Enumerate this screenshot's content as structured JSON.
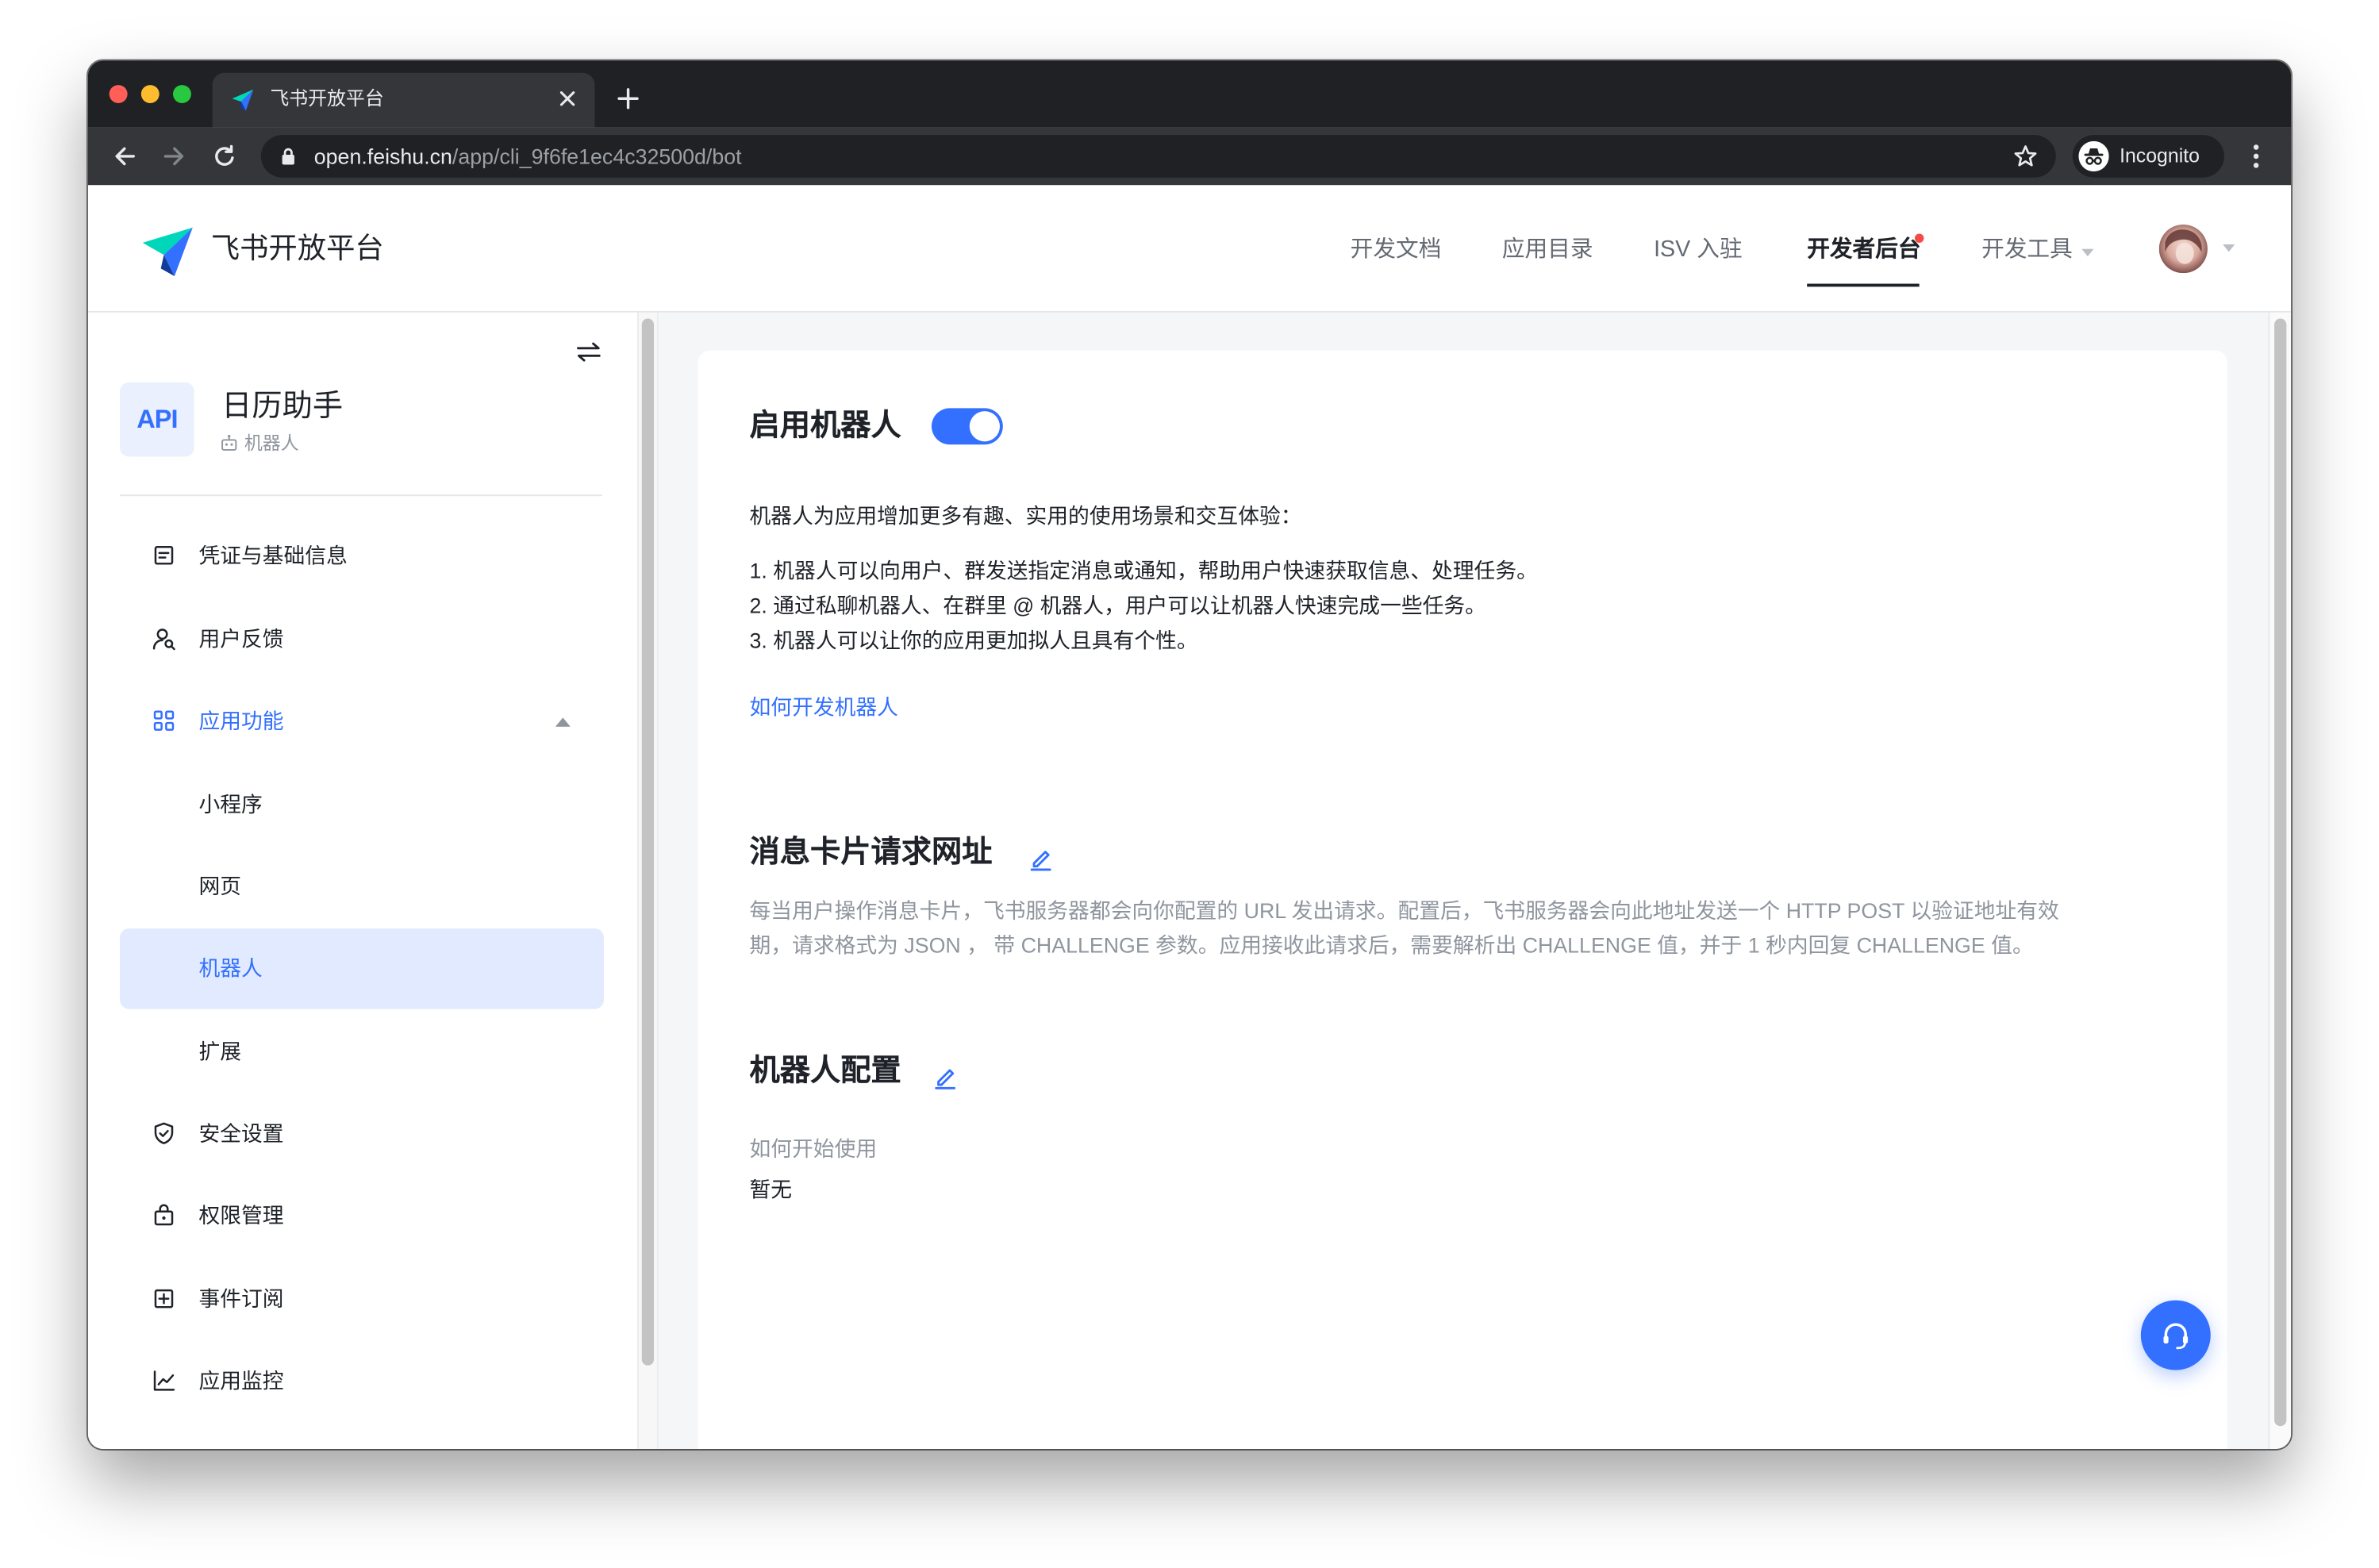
{
  "browser": {
    "tab_title": "飞书开放平台",
    "url_host": "open.feishu.cn",
    "url_path": "/app/cli_9f6fe1ec4c32500d/bot",
    "incognito_label": "Incognito"
  },
  "header": {
    "brand": "飞书开放平台",
    "nav": [
      {
        "label": "开发文档"
      },
      {
        "label": "应用目录"
      },
      {
        "label": "ISV 入驻"
      },
      {
        "label": "开发者后台",
        "active": true,
        "has_notification": true
      },
      {
        "label": "开发工具",
        "has_dropdown": true
      }
    ]
  },
  "app": {
    "icon_text": "API",
    "name": "日历助手",
    "type": "机器人"
  },
  "sidebar": {
    "items": [
      {
        "label": "凭证与基础信息",
        "icon": "document-icon"
      },
      {
        "label": "用户反馈",
        "icon": "user-feedback-icon"
      },
      {
        "label": "应用功能",
        "icon": "grid-icon",
        "expanded": true
      },
      {
        "label": "小程序",
        "sub": true
      },
      {
        "label": "网页",
        "sub": true
      },
      {
        "label": "机器人",
        "sub": true,
        "selected": true
      },
      {
        "label": "扩展",
        "sub": true
      },
      {
        "label": "安全设置",
        "icon": "shield-icon"
      },
      {
        "label": "权限管理",
        "icon": "lock-icon"
      },
      {
        "label": "事件订阅",
        "icon": "plus-square-icon"
      },
      {
        "label": "应用监控",
        "icon": "line-chart-icon"
      }
    ]
  },
  "main": {
    "bot_section": {
      "title": "启用机器人",
      "enabled": true,
      "intro": "机器人为应用增加更多有趣、实用的使用场景和交互体验：",
      "points": [
        "1. 机器人可以向用户、群发送指定消息或通知，帮助用户快速获取信息、处理任务。",
        "2. 通过私聊机器人、在群里 @ 机器人，用户可以让机器人快速完成一些任务。",
        "3. 机器人可以让你的应用更加拟人且具有个性。"
      ],
      "link": "如何开发机器人"
    },
    "card_url_section": {
      "title": "消息卡片请求网址",
      "description_lines": [
        "每当用户操作消息卡片，飞书服务器都会向你配置的 URL 发出请求。配置后，飞书服务器会向此地址发送一个 HTTP POST 以验证地址有效",
        "期，请求格式为 JSON ， 带 CHALLENGE 参数。应用接收此请求后，需要解析出 CHALLENGE 值，并于 1 秒内回复 CHALLENGE 值。"
      ]
    },
    "config_section": {
      "title": "机器人配置",
      "usage_label": "如何开始使用",
      "usage_value": "暂无"
    }
  },
  "colors": {
    "accent": "#3370ff",
    "selected_bg": "#e1eaff",
    "text_primary": "#1f2329",
    "text_secondary": "#8f959e",
    "notification": "#f54a45",
    "browser_chrome": "#35363a"
  },
  "icons": [
    "feishu-logo-icon",
    "tab-close-icon",
    "new-tab-icon",
    "back-icon",
    "forward-icon",
    "reload-icon",
    "lock-icon",
    "bookmark-star-icon",
    "incognito-icon",
    "browser-menu-icon",
    "chevron-down-icon",
    "collapse-sidebar-icon",
    "robot-icon",
    "chevron-up-icon",
    "edit-icon",
    "headset-icon"
  ]
}
